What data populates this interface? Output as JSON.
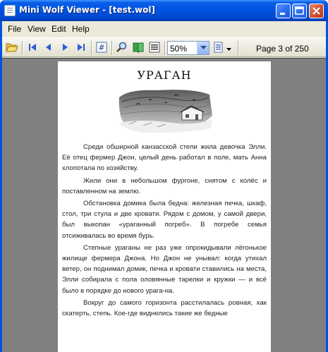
{
  "window": {
    "title": "Mini Wolf Viewer - [test.wol]"
  },
  "menu": {
    "items": [
      "File",
      "View",
      "Edit",
      "Help"
    ]
  },
  "toolbar": {
    "zoom_value": "50%",
    "page_indicator": "Page 3 of 250"
  },
  "icons": {
    "open": "folder-open-icon",
    "first": "first-page-icon",
    "prev": "previous-page-icon",
    "next": "next-page-icon",
    "last": "last-page-icon",
    "goto": "goto-page-icon",
    "find": "find-icon",
    "bookmarks": "book-icon",
    "contents": "contents-icon",
    "page_mode": "page-mode-icon"
  },
  "document": {
    "chapter_title": "УРАГАН",
    "paragraphs": [
      "Среди обширной канзасской степи жила девочка Элли. Её отец фермер Джон, целый день работал в поле, мать Анна хлопотала по хозяйству.",
      "Жили они в небольшом фургоне, снятом с колёс и поставленном на землю.",
      "Обстановка домика была бедна: железная печка, шкаф, стол, три стула и две кровати. Рядом с домом, у самой двери, был выкопан «ураганный погреб». В погребе семья отсиживалась во время бурь.",
      "Степные ураганы не раз уже опрокидывали лёгонькое жилище фермера Джона. Но Джон не унывал: когда утихал ветер, он поднимал домик, печка и кровати ставились на места, Элли собирала с пола оловянные тарелки и кружки — и всё было в порядке до нового урага-на.",
      "Вокруг до самого горизонта расстилалась ровная, как скатерть, степь. Кое-где виднелись такие же бедные"
    ]
  },
  "colors": {
    "titlebar": "#0054e3",
    "chrome": "#ece9d8",
    "viewport": "#808080",
    "page": "#ffffff"
  }
}
